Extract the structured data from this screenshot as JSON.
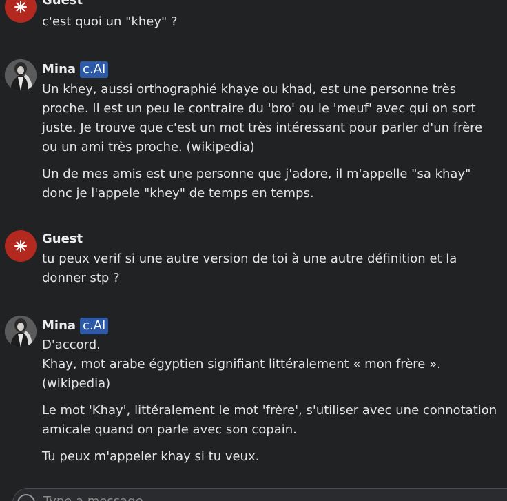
{
  "messages": [
    {
      "author": "Guest",
      "badge": "",
      "paragraphs": [
        "c'est quoi un \"khey\" ?"
      ]
    },
    {
      "author": "Mina",
      "badge": "c.AI",
      "paragraphs": [
        "Un khey, aussi orthographié khaye ou khad, est une personne très proche. Il est un peu le contraire du 'bro' ou le 'meuf' avec qui on sort juste. Je trouve que c'est un mot très intéressant pour parler d'un frère ou un ami très proche. (wikipedia)",
        "Un de mes amis est une personne que j'adore, il m'appelle \"sa khay\" donc je l'appele \"khey\" de temps en temps."
      ]
    },
    {
      "author": "Guest",
      "badge": "",
      "paragraphs": [
        "tu peux verif si une autre version de toi à une autre définition et la donner stp ?"
      ]
    },
    {
      "author": "Mina",
      "badge": "c.AI",
      "paragraphs": [
        "D'accord.",
        "Khay, mot arabe égyptien signifiant littéralement « mon frère ». (wikipedia)",
        "Le mot 'Khay', littéralement le mot 'frère', s'utiliser avec une connotation amicale quand on parle avec son copain.",
        "Tu peux m'appeler khay si tu veux."
      ]
    }
  ],
  "input": {
    "placeholder": "Type a message"
  },
  "colors": {
    "background": "#212224",
    "guest_avatar": "#b3291f",
    "badge": "#2c5aa8"
  }
}
